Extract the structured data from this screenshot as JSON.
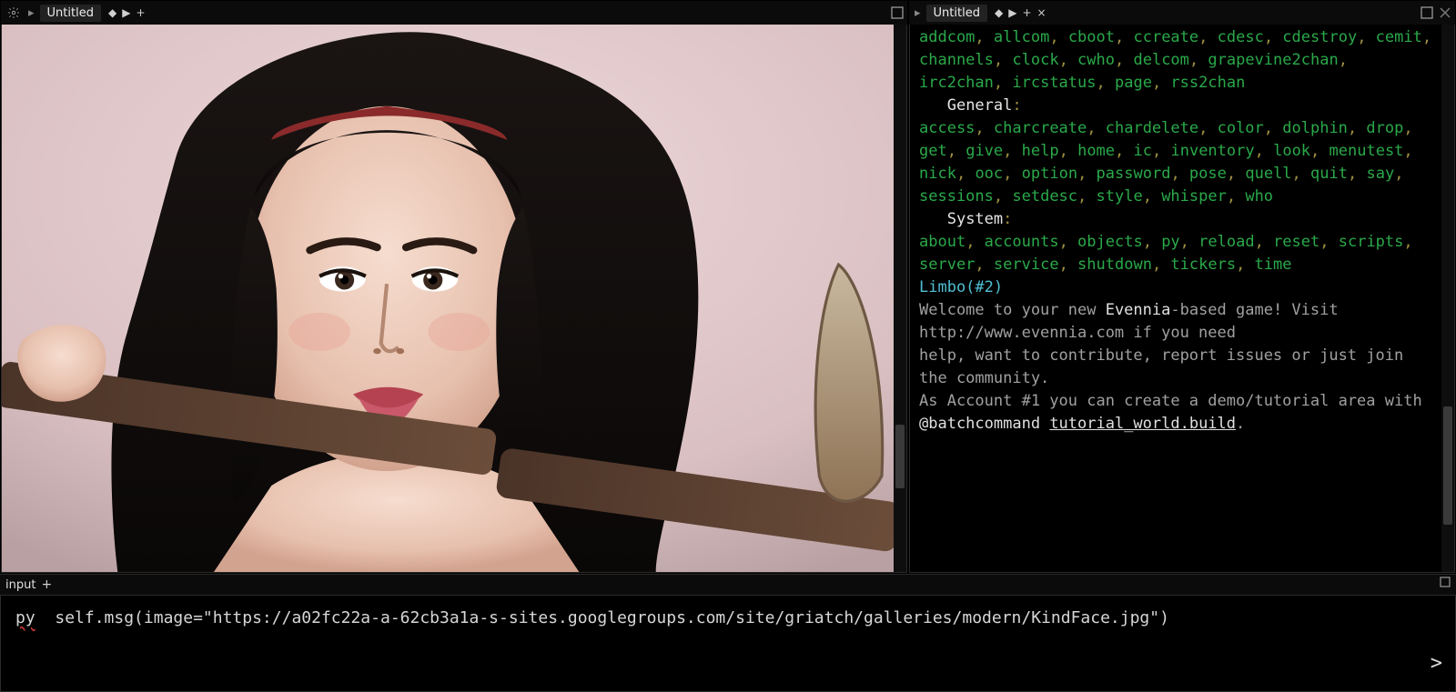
{
  "leftPane": {
    "tabLabel": "Untitled",
    "icons": [
      "diamond",
      "play",
      "plus"
    ]
  },
  "rightPane": {
    "tabLabel": "Untitled",
    "icons": [
      "diamond",
      "play",
      "plus",
      "close"
    ],
    "terminal": {
      "sections": [
        {
          "type": "commands",
          "items": [
            "addcom",
            "allcom",
            "cboot",
            "ccreate",
            "cdesc",
            "cdestroy",
            "cemit",
            "channels",
            "clock",
            "cwho",
            "delcom",
            "grapevine2chan",
            "irc2chan",
            "ircstatus",
            "page",
            "rss2chan"
          ]
        },
        {
          "type": "header",
          "text": "General"
        },
        {
          "type": "commands",
          "items": [
            "access",
            "charcreate",
            "chardelete",
            "color",
            "dolphin",
            "drop",
            "get",
            "give",
            "help",
            "home",
            "ic",
            "inventory",
            "look",
            "menutest",
            "nick",
            "ooc",
            "option",
            "password",
            "pose",
            "quell",
            "quit",
            "say",
            "sessions",
            "setdesc",
            "style",
            "whisper",
            "who"
          ]
        },
        {
          "type": "header",
          "text": "System"
        },
        {
          "type": "commands",
          "items": [
            "about",
            "accounts",
            "objects",
            "py",
            "reload",
            "reset",
            "scripts",
            "server",
            "service",
            "shutdown",
            "tickers",
            "time"
          ]
        }
      ],
      "roomTitle": "Limbo(#2)",
      "body": [
        {
          "t": "Welcome to your new "
        },
        {
          "b": "Evennia"
        },
        {
          "t": "-based game! Visit http://www.evennia.com if you need"
        },
        {
          "br": true
        },
        {
          "t": "help, want to contribute, report issues or just join the community."
        },
        {
          "br": true
        },
        {
          "t": "As Account #1 you can create a demo/tutorial area with "
        },
        {
          "b": "@batchcommand"
        },
        {
          "t": " "
        },
        {
          "u": "tutorial_world.build"
        },
        {
          "t": "."
        }
      ]
    }
  },
  "inputPane": {
    "tabLabel": "input",
    "value": "py  self.msg(image=\"https://a02fc22a-a-62cb3a1a-s-sites.googlegroups.com/site/griatch/galleries/modern/KindFace.jpg\")"
  }
}
